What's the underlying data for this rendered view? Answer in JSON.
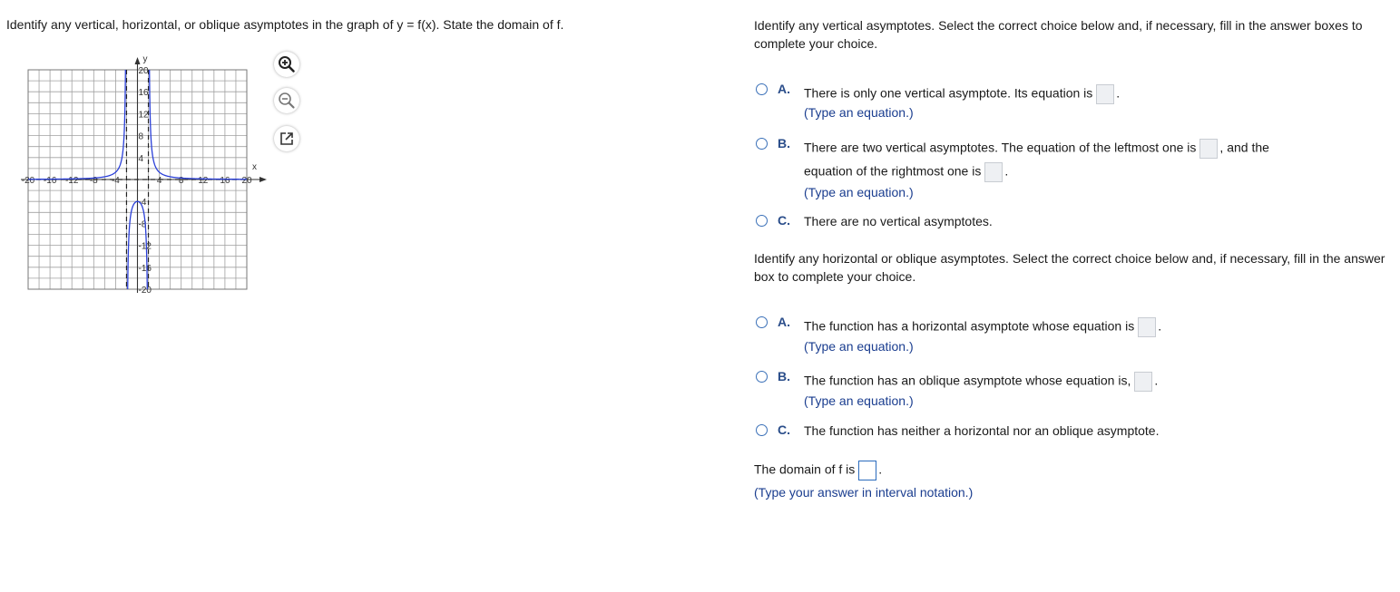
{
  "question": "Identify any vertical, horizontal, or oblique asymptotes in the graph of y = f(x). State the domain of f.",
  "graph": {
    "x_label": "x",
    "y_label": "y",
    "x_ticks": [
      "-20",
      "-16",
      "-12",
      "-8",
      "-4",
      "4",
      "8",
      "12",
      "16",
      "20"
    ],
    "y_ticks": [
      "20",
      "16",
      "12",
      "8",
      "4",
      "-4",
      "-8",
      "-12",
      "-16",
      "-20"
    ],
    "xlim": [
      -20,
      20
    ],
    "ylim": [
      -20,
      20
    ],
    "vertical_dashed_lines": [
      -2,
      2
    ],
    "horizontal_dashed_line": 0,
    "curve_color": "#2a3fd8"
  },
  "tools": [
    "zoom-in-icon",
    "zoom-out-icon",
    "open-new-window-icon"
  ],
  "vertical_section": {
    "instruction": "Identify any vertical asymptotes. Select the correct choice below and, if necessary, fill in the answer boxes to complete your choice.",
    "options": [
      {
        "letter": "A.",
        "text": "There is only one vertical asymptote. Its equation is",
        "hint": "(Type an equation.)"
      },
      {
        "letter": "B.",
        "text": "There are two vertical asymptotes. The equation of the leftmost one is",
        "text_after": ", and the",
        "text2": "equation of the rightmost one is",
        "hint": "(Type an equation.)"
      },
      {
        "letter": "C.",
        "text": "There are no vertical asymptotes."
      }
    ]
  },
  "horizontal_section": {
    "instruction": "Identify any horizontal or oblique asymptotes. Select the correct choice below and, if necessary, fill in the answer box to complete your choice.",
    "options": [
      {
        "letter": "A.",
        "text": "The function has a horizontal asymptote whose equation is",
        "hint": "(Type an equation.)"
      },
      {
        "letter": "B.",
        "text": "The function has an oblique asymptote whose equation is,",
        "hint": "(Type an equation.)"
      },
      {
        "letter": "C.",
        "text": "The function has neither a horizontal nor an oblique asymptote."
      }
    ]
  },
  "domain": {
    "text": "The domain of f is",
    "hint": "(Type your answer in interval notation.)"
  }
}
